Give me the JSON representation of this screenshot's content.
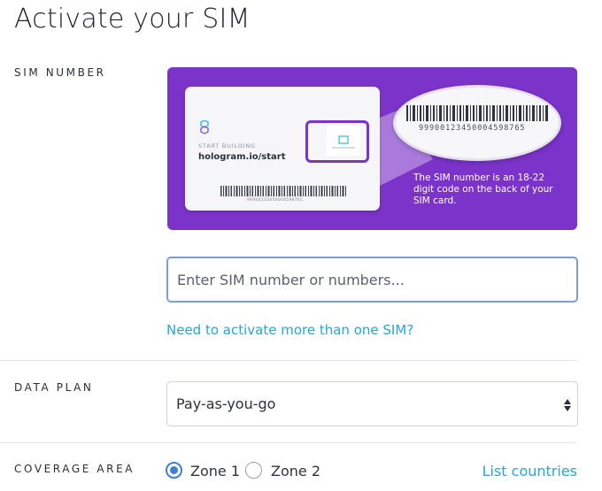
{
  "page": {
    "title": "Activate your SIM"
  },
  "sim_number": {
    "label": "SIM NUMBER",
    "illustration": {
      "card_tagline": "START BUILDING",
      "card_url": "hologram.io/start",
      "card_barcode_number": "99900123450004598765",
      "magnified_number": "99900123450004598765",
      "caption": "The SIM number is an 18-22 digit code on the back of your SIM card."
    },
    "input": {
      "placeholder": "Enter SIM number or numbers...",
      "value": ""
    },
    "more_link": "Need to activate more than one SIM?"
  },
  "data_plan": {
    "label": "DATA PLAN",
    "selected": "Pay-as-you-go"
  },
  "coverage_area": {
    "label": "COVERAGE AREA",
    "options": [
      {
        "label": "Zone 1",
        "checked": true
      },
      {
        "label": "Zone 2",
        "checked": false
      }
    ],
    "list_link": "List countries"
  },
  "colors": {
    "brand_purple": "#7b33c9",
    "link_blue": "#27a6d7",
    "radio_blue": "#3f7ddc"
  },
  "icons": [
    "hologram-logo-icon",
    "sim-chip-icon",
    "barcode-icon",
    "select-arrows-icon"
  ]
}
